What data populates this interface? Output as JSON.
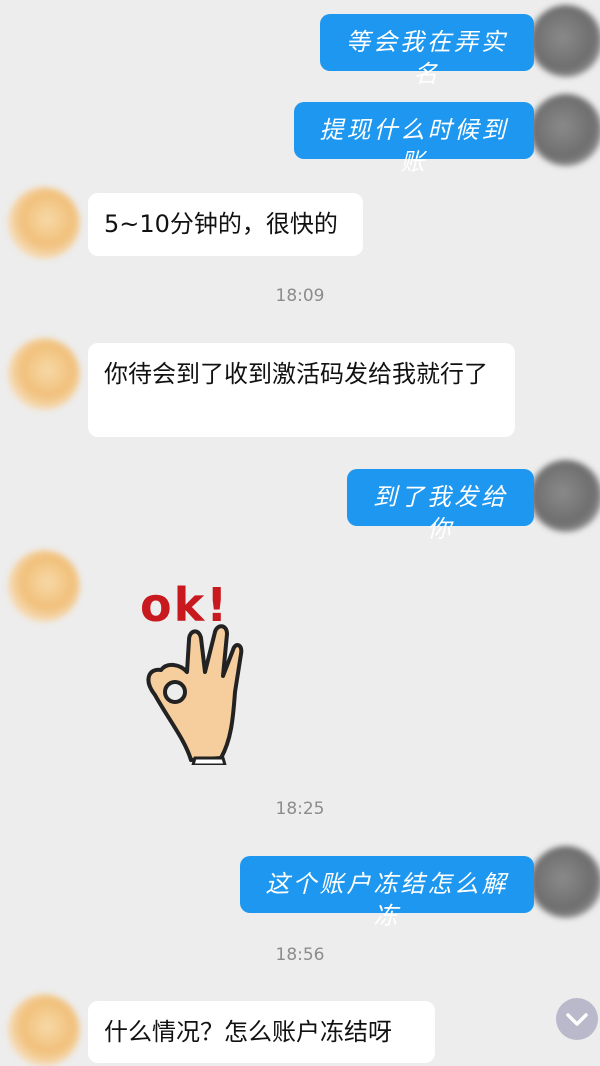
{
  "messages": [
    {
      "from": "me",
      "text": "等会我在弄实名"
    },
    {
      "from": "me",
      "text": "提现什么时候到账"
    },
    {
      "from": "other",
      "text": "5~10分钟的，很快的"
    },
    {
      "time": "18:09"
    },
    {
      "from": "other",
      "text": "你待会到了收到激活码发给我就行了"
    },
    {
      "from": "me",
      "text": "到了我发给你"
    },
    {
      "from": "other",
      "sticker": "ok"
    },
    {
      "time": "18:25"
    },
    {
      "from": "me",
      "text": "这个账户冻结怎么解冻"
    },
    {
      "time": "18:56"
    },
    {
      "from": "other",
      "text": "什么情况？怎么账户冻结呀"
    }
  ],
  "sticker": {
    "text": "ok!",
    "icon": "ok-hand-gesture"
  },
  "scroll_button": {
    "icon": "chevron-down-icon"
  },
  "colors": {
    "background": "#ededed",
    "my_bubble": "#1d97f0",
    "other_bubble": "#ffffff",
    "sticker_text": "#c8191e"
  }
}
